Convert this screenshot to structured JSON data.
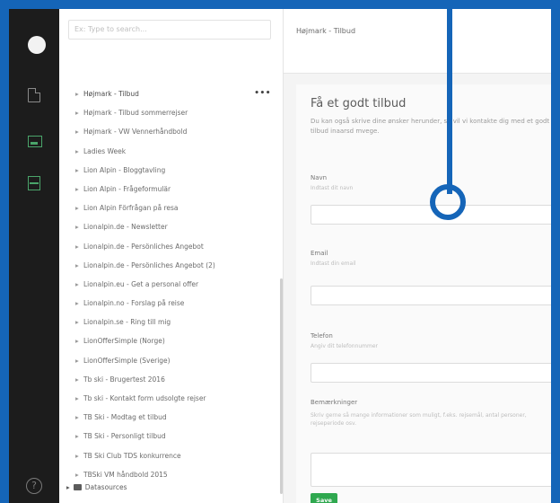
{
  "search": {
    "placeholder": "Ex: Type to search..."
  },
  "tree": {
    "items": [
      {
        "label": "Højmark - Tilbud",
        "selected": true
      },
      {
        "label": "Højmark - Tilbud sommerrejser"
      },
      {
        "label": "Højmark - VW Vennerhåndbold"
      },
      {
        "label": "Ladies Week"
      },
      {
        "label": "Lion Alpin - Bloggtavling"
      },
      {
        "label": "Lion Alpin - Frågeformulär"
      },
      {
        "label": "Lion Alpin Förfrågan på resa"
      },
      {
        "label": "Lionalpin.de - Newsletter"
      },
      {
        "label": "Lionalpin.de - Persönliches Angebot"
      },
      {
        "label": "Lionalpin.de - Persönliches Angebot (2)"
      },
      {
        "label": "Lionalpin.eu - Get a personal offer"
      },
      {
        "label": "Lionalpin.no - Forslag på reise"
      },
      {
        "label": "Lionalpin.se - Ring till mig"
      },
      {
        "label": "LionOfferSimple (Norge)"
      },
      {
        "label": "LionOfferSimple (Sverige)"
      },
      {
        "label": "Tb ski - Brugertest 2016"
      },
      {
        "label": "Tb ski - Kontakt form udsolgte rejser"
      },
      {
        "label": "TB Ski - Modtag et tilbud"
      },
      {
        "label": "TB Ski - Personligt tilbud"
      },
      {
        "label": "TB Ski Club TDS konkurrence"
      },
      {
        "label": "TBSki VM håndbold 2015"
      }
    ],
    "more_label": "•••",
    "folder_label": "Datasources"
  },
  "header": {
    "title": "Højmark - Tilbud"
  },
  "form": {
    "heading": "Få et godt tilbud",
    "intro": "Du kan også skrive dine ønsker herunder, så vil vi kontakte dig med et godt tilbud inaarsd mvege.",
    "fields": [
      {
        "label": "Navn",
        "hint": "Indtast dit navn"
      },
      {
        "label": "Email",
        "hint": "Indtast din email"
      },
      {
        "label": "Telefon",
        "hint": "Angiv dit telefonnummer"
      },
      {
        "label": "Bemærkninger",
        "hint": "Skriv gerne så mange informationer som muligt, f.eks. rejsemål, antal personer, rejseperiode osv."
      }
    ],
    "save_label": "Save"
  },
  "colors": {
    "accent": "#1565b8",
    "save": "#2fa84f",
    "rail": "#1c1c1c"
  }
}
